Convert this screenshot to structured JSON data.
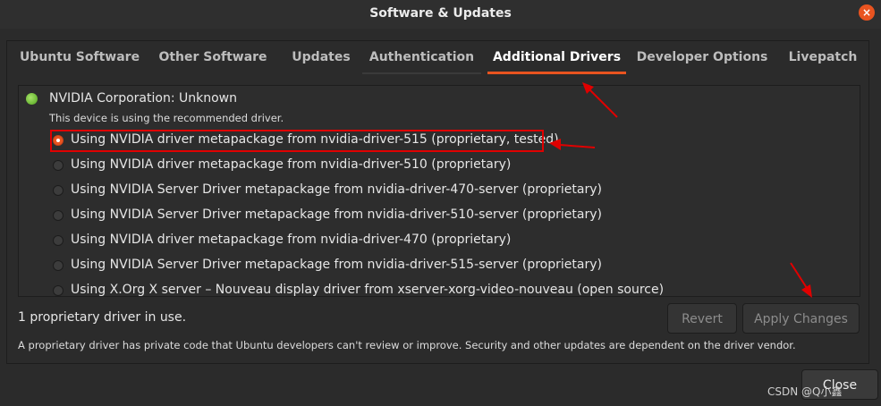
{
  "window": {
    "title": "Software & Updates"
  },
  "tabs": [
    {
      "label": "Ubuntu Software"
    },
    {
      "label": "Other Software"
    },
    {
      "label": "Updates"
    },
    {
      "label": "Authentication"
    },
    {
      "label": "Additional Drivers"
    },
    {
      "label": "Developer Options"
    },
    {
      "label": "Livepatch"
    }
  ],
  "active_tab": "Additional Drivers",
  "device": {
    "name": "NVIDIA Corporation: Unknown",
    "status": "This device is using the recommended driver."
  },
  "drivers": [
    {
      "label": "Using NVIDIA driver metapackage from nvidia-driver-515 (proprietary, tested)",
      "selected": true
    },
    {
      "label": "Using NVIDIA driver metapackage from nvidia-driver-510 (proprietary)",
      "selected": false
    },
    {
      "label": "Using NVIDIA Server Driver metapackage from nvidia-driver-470-server (proprietary)",
      "selected": false
    },
    {
      "label": "Using NVIDIA Server Driver metapackage from nvidia-driver-510-server (proprietary)",
      "selected": false
    },
    {
      "label": "Using NVIDIA driver metapackage from nvidia-driver-470 (proprietary)",
      "selected": false
    },
    {
      "label": "Using NVIDIA Server Driver metapackage from nvidia-driver-515-server (proprietary)",
      "selected": false
    },
    {
      "label": "Using X.Org X server – Nouveau display driver from xserver-xorg-video-nouveau (open source)",
      "selected": false
    }
  ],
  "footer": {
    "in_use": "1 proprietary driver in use.",
    "revert_label": "Revert",
    "apply_label": "Apply Changes",
    "note": "A proprietary driver has private code that Ubuntu developers can't review or improve. Security and other updates are dependent on the driver vendor."
  },
  "close_label": "Close",
  "watermark": "CSDN @Q小鑫",
  "colors": {
    "accent": "#e95420",
    "annotation": "#e00000",
    "device_ok": "#6cc62a"
  },
  "icons": {
    "window_close": "close-icon",
    "device_status": "green-dot-icon"
  }
}
